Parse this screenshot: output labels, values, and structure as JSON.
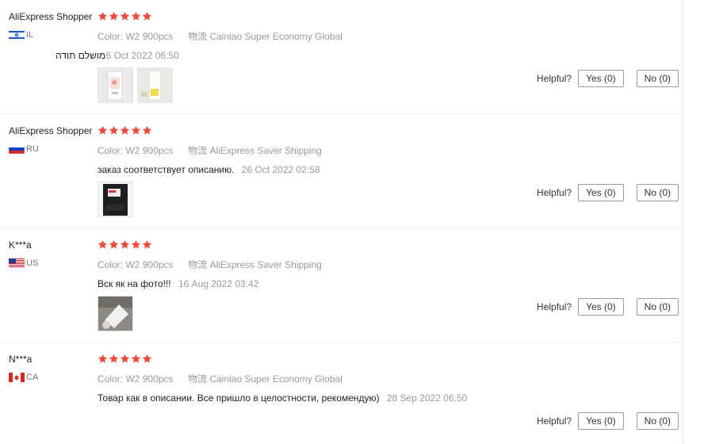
{
  "labels": {
    "color_key": "Color:",
    "logistics_key": "物流",
    "helpful": "Helpful?",
    "yes": "Yes (0)",
    "no": "No (0)"
  },
  "reviews": [
    {
      "user": "AliExpress Shopper",
      "country": "IL",
      "rating": 5,
      "color": "W2 900pcs",
      "logistics": "Cainiao Super Economy Global",
      "feedback": "מושלם תודה",
      "date": "06 Oct 2022 06:50",
      "images": [
        "product-photo-1",
        "product-photo-2"
      ]
    },
    {
      "user": "AliExpress Shopper",
      "country": "RU",
      "rating": 5,
      "color": "W2 900pcs",
      "logistics": "AliExpress Saver Shipping",
      "feedback": "заказ соответствует описанию.",
      "date": "26 Oct 2022 02:58",
      "images": [
        "product-photo-1"
      ]
    },
    {
      "user": "K***a",
      "country": "US",
      "rating": 5,
      "color": "W2 900pcs",
      "logistics": "AliExpress Saver Shipping",
      "feedback": "Вск як на фото!!!",
      "date": "16 Aug 2022 03:42",
      "images": [
        "product-photo-1"
      ]
    },
    {
      "user": "N***a",
      "country": "CA",
      "rating": 5,
      "color": "W2 900pcs",
      "logistics": "Cainiao Super Economy Global",
      "feedback": "Товар как в описании. Все пришло в целостности, рекомендую)",
      "date": "28 Sep 2022 06:50",
      "images": []
    }
  ],
  "colors": {
    "star": "#f04a3c",
    "text_muted": "#999999",
    "border": "#999999"
  }
}
